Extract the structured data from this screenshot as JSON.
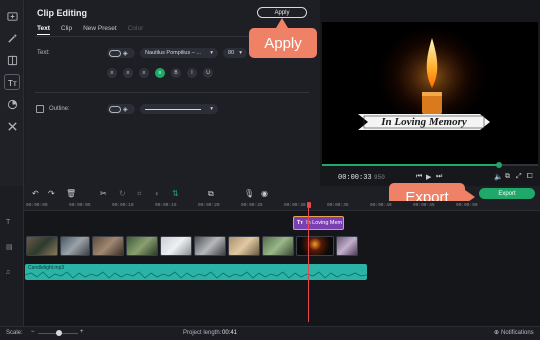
{
  "sidebar": {
    "items": [
      {
        "name": "import-icon"
      },
      {
        "name": "magic-wand-icon"
      },
      {
        "name": "transitions-icon"
      },
      {
        "name": "titles-icon"
      },
      {
        "name": "stickers-icon"
      },
      {
        "name": "tools-icon"
      }
    ]
  },
  "panel": {
    "title": "Clip Editing",
    "apply_label": "Apply",
    "tabs": [
      {
        "label": "Text",
        "state": "active"
      },
      {
        "label": "Clip",
        "state": "normal"
      },
      {
        "label": "New Preset",
        "state": "normal"
      },
      {
        "label": "Color",
        "state": "disabled"
      }
    ],
    "text_label": "Text:",
    "font_name": "Nautilus Pompilius – ...",
    "font_size": "80",
    "align_buttons": [
      "≡",
      "≡",
      "≡",
      "≡",
      "B",
      "I",
      "U"
    ],
    "outline_label": "Outline:"
  },
  "callouts": {
    "apply": "Apply",
    "export": "Export"
  },
  "preview": {
    "banner_text": "In Loving Memory",
    "timecode": "00:00:33",
    "timecode_frames": "950",
    "progress": 0.82,
    "accent": "#1fa86a"
  },
  "timeline": {
    "export_label": "Export",
    "ruler_ticks": [
      "00:00:00",
      "00:00:05",
      "00:00:10",
      "00:00:15",
      "00:00:20",
      "00:00:25",
      "00:00:30",
      "00:00:35",
      "00:00:40",
      "00:00:45",
      "00:00:50"
    ],
    "title_clip_label": "In Loving Mem",
    "audio_clip_label": "Candlelight.mp3",
    "playhead_color": "#e5484d",
    "audio_color": "#2bb3a8",
    "title_clip_color": "#7a3fb0"
  },
  "status": {
    "scale_label": "Scale:",
    "project_length_label": "Project length:",
    "project_length_value": "00:41",
    "notifications_label": "Notifications"
  }
}
